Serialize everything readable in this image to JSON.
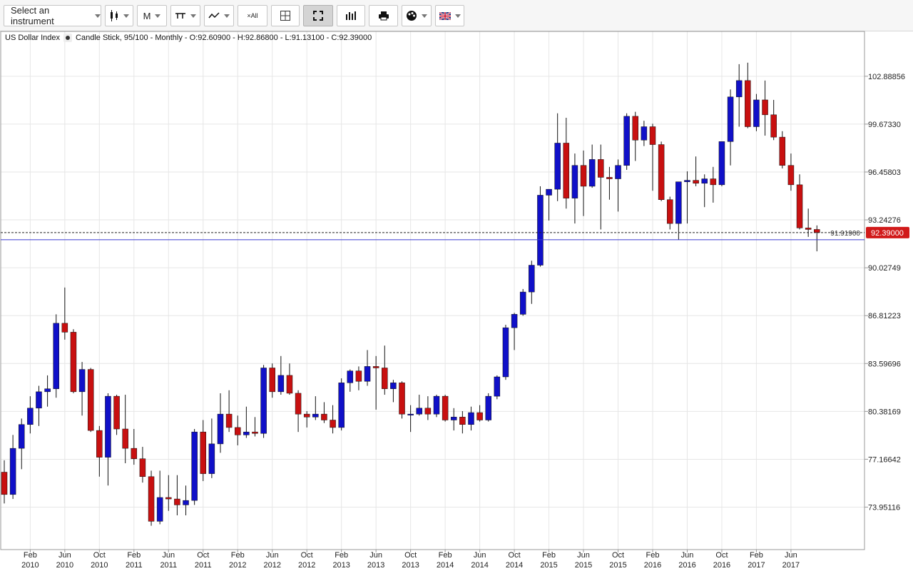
{
  "toolbar": {
    "instrument_placeholder": "Select an instrument",
    "period_label": "M",
    "crosshair_label": "×All"
  },
  "chart_title": {
    "instrument": "US Dollar Index",
    "info": "Candle Stick, 95/100 - Monthly - O:92.60900 - H:92.86800 - L:91.13100 - C:92.39000"
  },
  "colors": {
    "up": "#1010c8",
    "down": "#c81010",
    "price_label_bg": "#d11a1a",
    "horizontal_line": "#3a3ad0",
    "grid": "#e6e6e6"
  },
  "chart_data": {
    "type": "candlestick",
    "series_name": "US Dollar Index",
    "ylim": [
      71.1,
      105.9
    ],
    "y_ticks": [
      "102.88856",
      "99.67330",
      "96.45803",
      "93.24276",
      "90.02749",
      "86.81223",
      "83.59696",
      "80.38169",
      "77.16642",
      "73.95116"
    ],
    "x_tick_labels": [
      {
        "month": "Feb",
        "year": "2010"
      },
      {
        "month": "Jun",
        "year": "2010"
      },
      {
        "month": "Oct",
        "year": "2010"
      },
      {
        "month": "Feb",
        "year": "2011"
      },
      {
        "month": "Jun",
        "year": "2011"
      },
      {
        "month": "Oct",
        "year": "2011"
      },
      {
        "month": "Feb",
        "year": "2012"
      },
      {
        "month": "Jun",
        "year": "2012"
      },
      {
        "month": "Oct",
        "year": "2012"
      },
      {
        "month": "Feb",
        "year": "2013"
      },
      {
        "month": "Jun",
        "year": "2013"
      },
      {
        "month": "Oct",
        "year": "2013"
      },
      {
        "month": "Feb",
        "year": "2014"
      },
      {
        "month": "Jun",
        "year": "2014"
      },
      {
        "month": "Oct",
        "year": "2014"
      },
      {
        "month": "Feb",
        "year": "2015"
      },
      {
        "month": "Jun",
        "year": "2015"
      },
      {
        "month": "Oct",
        "year": "2015"
      },
      {
        "month": "Feb",
        "year": "2016"
      },
      {
        "month": "Jun",
        "year": "2016"
      },
      {
        "month": "Oct",
        "year": "2016"
      },
      {
        "month": "Feb",
        "year": "2017"
      },
      {
        "month": "Jun",
        "year": "2017"
      }
    ],
    "horizontal_line": {
      "value": 91.91,
      "label": "91.91900"
    },
    "last_price": {
      "value": 92.39,
      "label": "92.39000"
    },
    "candles": [
      {
        "date": "2009-11",
        "o": 76.3,
        "h": 77.1,
        "l": 74.2,
        "c": 74.8
      },
      {
        "date": "2009-12",
        "o": 74.8,
        "h": 78.8,
        "l": 74.5,
        "c": 77.9
      },
      {
        "date": "2010-01",
        "o": 77.9,
        "h": 79.9,
        "l": 76.5,
        "c": 79.5
      },
      {
        "date": "2010-02",
        "o": 79.5,
        "h": 81.4,
        "l": 78.9,
        "c": 80.6
      },
      {
        "date": "2010-03",
        "o": 80.6,
        "h": 82.1,
        "l": 79.4,
        "c": 81.7
      },
      {
        "date": "2010-04",
        "o": 81.7,
        "h": 82.8,
        "l": 80.7,
        "c": 81.9
      },
      {
        "date": "2010-05",
        "o": 81.9,
        "h": 86.9,
        "l": 81.3,
        "c": 86.3
      },
      {
        "date": "2010-06",
        "o": 86.3,
        "h": 88.7,
        "l": 85.2,
        "c": 85.7
      },
      {
        "date": "2010-07",
        "o": 85.7,
        "h": 85.9,
        "l": 81.6,
        "c": 81.7
      },
      {
        "date": "2010-08",
        "o": 81.7,
        "h": 83.7,
        "l": 80.1,
        "c": 83.2
      },
      {
        "date": "2010-09",
        "o": 83.2,
        "h": 83.3,
        "l": 79.0,
        "c": 79.1
      },
      {
        "date": "2010-10",
        "o": 79.1,
        "h": 79.4,
        "l": 76.0,
        "c": 77.3
      },
      {
        "date": "2010-11",
        "o": 77.3,
        "h": 81.6,
        "l": 75.4,
        "c": 81.4
      },
      {
        "date": "2010-12",
        "o": 81.4,
        "h": 81.5,
        "l": 78.8,
        "c": 79.2
      },
      {
        "date": "2011-01",
        "o": 79.2,
        "h": 81.5,
        "l": 76.9,
        "c": 77.9
      },
      {
        "date": "2011-02",
        "o": 77.9,
        "h": 79.2,
        "l": 76.8,
        "c": 77.2
      },
      {
        "date": "2011-03",
        "o": 77.2,
        "h": 78.0,
        "l": 75.6,
        "c": 76.0
      },
      {
        "date": "2011-04",
        "o": 76.0,
        "h": 76.4,
        "l": 72.7,
        "c": 73.0
      },
      {
        "date": "2011-05",
        "o": 73.0,
        "h": 76.4,
        "l": 72.8,
        "c": 74.6
      },
      {
        "date": "2011-06",
        "o": 74.6,
        "h": 76.1,
        "l": 73.7,
        "c": 74.5
      },
      {
        "date": "2011-07",
        "o": 74.5,
        "h": 76.1,
        "l": 73.4,
        "c": 74.1
      },
      {
        "date": "2011-08",
        "o": 74.1,
        "h": 75.4,
        "l": 73.4,
        "c": 74.4
      },
      {
        "date": "2011-09",
        "o": 74.4,
        "h": 79.2,
        "l": 74.1,
        "c": 79.0
      },
      {
        "date": "2011-10",
        "o": 79.0,
        "h": 79.8,
        "l": 75.7,
        "c": 76.2
      },
      {
        "date": "2011-11",
        "o": 76.2,
        "h": 79.9,
        "l": 75.9,
        "c": 78.2
      },
      {
        "date": "2011-12",
        "o": 78.2,
        "h": 81.6,
        "l": 77.6,
        "c": 80.2
      },
      {
        "date": "2012-01",
        "o": 80.2,
        "h": 81.8,
        "l": 79.0,
        "c": 79.3
      },
      {
        "date": "2012-02",
        "o": 79.3,
        "h": 80.1,
        "l": 78.1,
        "c": 78.8
      },
      {
        "date": "2012-03",
        "o": 78.8,
        "h": 80.7,
        "l": 78.6,
        "c": 79.0
      },
      {
        "date": "2012-04",
        "o": 79.0,
        "h": 80.0,
        "l": 78.7,
        "c": 78.9
      },
      {
        "date": "2012-05",
        "o": 78.9,
        "h": 83.5,
        "l": 78.6,
        "c": 83.3
      },
      {
        "date": "2012-06",
        "o": 83.3,
        "h": 83.6,
        "l": 81.3,
        "c": 81.7
      },
      {
        "date": "2012-07",
        "o": 81.7,
        "h": 84.1,
        "l": 81.5,
        "c": 82.8
      },
      {
        "date": "2012-08",
        "o": 82.8,
        "h": 83.6,
        "l": 81.5,
        "c": 81.6
      },
      {
        "date": "2012-09",
        "o": 81.6,
        "h": 81.8,
        "l": 79.0,
        "c": 80.2
      },
      {
        "date": "2012-10",
        "o": 80.2,
        "h": 80.4,
        "l": 79.3,
        "c": 80.0
      },
      {
        "date": "2012-11",
        "o": 80.0,
        "h": 81.4,
        "l": 79.8,
        "c": 80.2
      },
      {
        "date": "2012-12",
        "o": 80.2,
        "h": 81.0,
        "l": 79.6,
        "c": 79.8
      },
      {
        "date": "2013-01",
        "o": 79.8,
        "h": 80.8,
        "l": 78.9,
        "c": 79.3
      },
      {
        "date": "2013-02",
        "o": 79.3,
        "h": 82.6,
        "l": 79.1,
        "c": 82.3
      },
      {
        "date": "2013-03",
        "o": 82.3,
        "h": 83.2,
        "l": 81.7,
        "c": 83.1
      },
      {
        "date": "2013-04",
        "o": 83.1,
        "h": 83.4,
        "l": 81.8,
        "c": 82.4
      },
      {
        "date": "2013-05",
        "o": 82.4,
        "h": 84.5,
        "l": 82.1,
        "c": 83.4
      },
      {
        "date": "2013-06",
        "o": 83.4,
        "h": 84.1,
        "l": 80.5,
        "c": 83.3
      },
      {
        "date": "2013-07",
        "o": 83.3,
        "h": 84.8,
        "l": 81.5,
        "c": 81.9
      },
      {
        "date": "2013-08",
        "o": 81.9,
        "h": 82.5,
        "l": 81.0,
        "c": 82.3
      },
      {
        "date": "2013-09",
        "o": 82.3,
        "h": 82.4,
        "l": 79.9,
        "c": 80.2
      },
      {
        "date": "2013-10",
        "o": 80.2,
        "h": 80.8,
        "l": 79.0,
        "c": 80.2
      },
      {
        "date": "2013-11",
        "o": 80.2,
        "h": 81.5,
        "l": 80.1,
        "c": 80.6
      },
      {
        "date": "2013-12",
        "o": 80.6,
        "h": 81.4,
        "l": 79.8,
        "c": 80.2
      },
      {
        "date": "2014-01",
        "o": 80.2,
        "h": 81.5,
        "l": 80.0,
        "c": 81.4
      },
      {
        "date": "2014-02",
        "o": 81.4,
        "h": 81.5,
        "l": 79.7,
        "c": 79.8
      },
      {
        "date": "2014-03",
        "o": 79.8,
        "h": 80.6,
        "l": 79.1,
        "c": 80.0
      },
      {
        "date": "2014-04",
        "o": 80.0,
        "h": 80.4,
        "l": 78.9,
        "c": 79.5
      },
      {
        "date": "2014-05",
        "o": 79.5,
        "h": 80.7,
        "l": 79.1,
        "c": 80.3
      },
      {
        "date": "2014-06",
        "o": 80.3,
        "h": 80.8,
        "l": 79.7,
        "c": 79.8
      },
      {
        "date": "2014-07",
        "o": 79.8,
        "h": 81.6,
        "l": 79.7,
        "c": 81.4
      },
      {
        "date": "2014-08",
        "o": 81.4,
        "h": 82.8,
        "l": 81.2,
        "c": 82.7
      },
      {
        "date": "2014-09",
        "o": 82.7,
        "h": 86.2,
        "l": 82.5,
        "c": 86.0
      },
      {
        "date": "2014-10",
        "o": 86.0,
        "h": 87.0,
        "l": 84.5,
        "c": 86.9
      },
      {
        "date": "2014-11",
        "o": 86.9,
        "h": 88.6,
        "l": 86.8,
        "c": 88.4
      },
      {
        "date": "2014-12",
        "o": 88.4,
        "h": 90.5,
        "l": 87.6,
        "c": 90.2
      },
      {
        "date": "2015-01",
        "o": 90.2,
        "h": 95.5,
        "l": 90.1,
        "c": 94.9
      },
      {
        "date": "2015-02",
        "o": 94.9,
        "h": 95.3,
        "l": 93.2,
        "c": 95.3
      },
      {
        "date": "2015-03",
        "o": 95.3,
        "h": 100.4,
        "l": 94.5,
        "c": 98.4
      },
      {
        "date": "2015-04",
        "o": 98.4,
        "h": 100.1,
        "l": 94.0,
        "c": 94.7
      },
      {
        "date": "2015-05",
        "o": 94.7,
        "h": 97.7,
        "l": 93.0,
        "c": 96.9
      },
      {
        "date": "2015-06",
        "o": 96.9,
        "h": 97.9,
        "l": 93.5,
        "c": 95.5
      },
      {
        "date": "2015-07",
        "o": 95.5,
        "h": 98.3,
        "l": 95.4,
        "c": 97.3
      },
      {
        "date": "2015-08",
        "o": 97.3,
        "h": 98.3,
        "l": 92.6,
        "c": 96.1
      },
      {
        "date": "2015-09",
        "o": 96.1,
        "h": 96.8,
        "l": 94.6,
        "c": 96.0
      },
      {
        "date": "2015-10",
        "o": 96.0,
        "h": 97.3,
        "l": 93.8,
        "c": 96.9
      },
      {
        "date": "2015-11",
        "o": 96.9,
        "h": 100.4,
        "l": 96.6,
        "c": 100.2
      },
      {
        "date": "2015-12",
        "o": 100.2,
        "h": 100.5,
        "l": 97.2,
        "c": 98.6
      },
      {
        "date": "2016-01",
        "o": 98.6,
        "h": 99.9,
        "l": 98.2,
        "c": 99.5
      },
      {
        "date": "2016-02",
        "o": 99.5,
        "h": 99.7,
        "l": 95.2,
        "c": 98.3
      },
      {
        "date": "2016-03",
        "o": 98.3,
        "h": 98.5,
        "l": 94.5,
        "c": 94.6
      },
      {
        "date": "2016-04",
        "o": 94.6,
        "h": 94.8,
        "l": 92.6,
        "c": 93.0
      },
      {
        "date": "2016-05",
        "o": 93.0,
        "h": 95.8,
        "l": 91.9,
        "c": 95.8
      },
      {
        "date": "2016-06",
        "o": 95.8,
        "h": 96.5,
        "l": 93.0,
        "c": 95.9
      },
      {
        "date": "2016-07",
        "o": 95.9,
        "h": 97.5,
        "l": 95.5,
        "c": 95.7
      },
      {
        "date": "2016-08",
        "o": 95.7,
        "h": 96.3,
        "l": 94.1,
        "c": 96.0
      },
      {
        "date": "2016-09",
        "o": 96.0,
        "h": 96.8,
        "l": 94.4,
        "c": 95.6
      },
      {
        "date": "2016-10",
        "o": 95.6,
        "h": 98.5,
        "l": 95.5,
        "c": 98.5
      },
      {
        "date": "2016-11",
        "o": 98.5,
        "h": 102.0,
        "l": 96.9,
        "c": 101.5
      },
      {
        "date": "2016-12",
        "o": 101.5,
        "h": 103.7,
        "l": 99.5,
        "c": 102.6
      },
      {
        "date": "2017-01",
        "o": 102.6,
        "h": 103.8,
        "l": 99.4,
        "c": 99.5
      },
      {
        "date": "2017-02",
        "o": 99.5,
        "h": 101.7,
        "l": 99.2,
        "c": 101.3
      },
      {
        "date": "2017-03",
        "o": 101.3,
        "h": 102.6,
        "l": 98.9,
        "c": 100.3
      },
      {
        "date": "2017-04",
        "o": 100.3,
        "h": 101.3,
        "l": 98.6,
        "c": 98.8
      },
      {
        "date": "2017-05",
        "o": 98.8,
        "h": 99.2,
        "l": 96.7,
        "c": 96.9
      },
      {
        "date": "2017-06",
        "o": 96.9,
        "h": 97.7,
        "l": 95.2,
        "c": 95.6
      },
      {
        "date": "2017-07",
        "o": 95.6,
        "h": 96.3,
        "l": 92.6,
        "c": 92.7
      },
      {
        "date": "2017-08",
        "o": 92.7,
        "h": 94.0,
        "l": 92.1,
        "c": 92.6
      },
      {
        "date": "2017-09",
        "o": 92.6,
        "h": 92.87,
        "l": 91.13,
        "c": 92.39
      }
    ]
  }
}
